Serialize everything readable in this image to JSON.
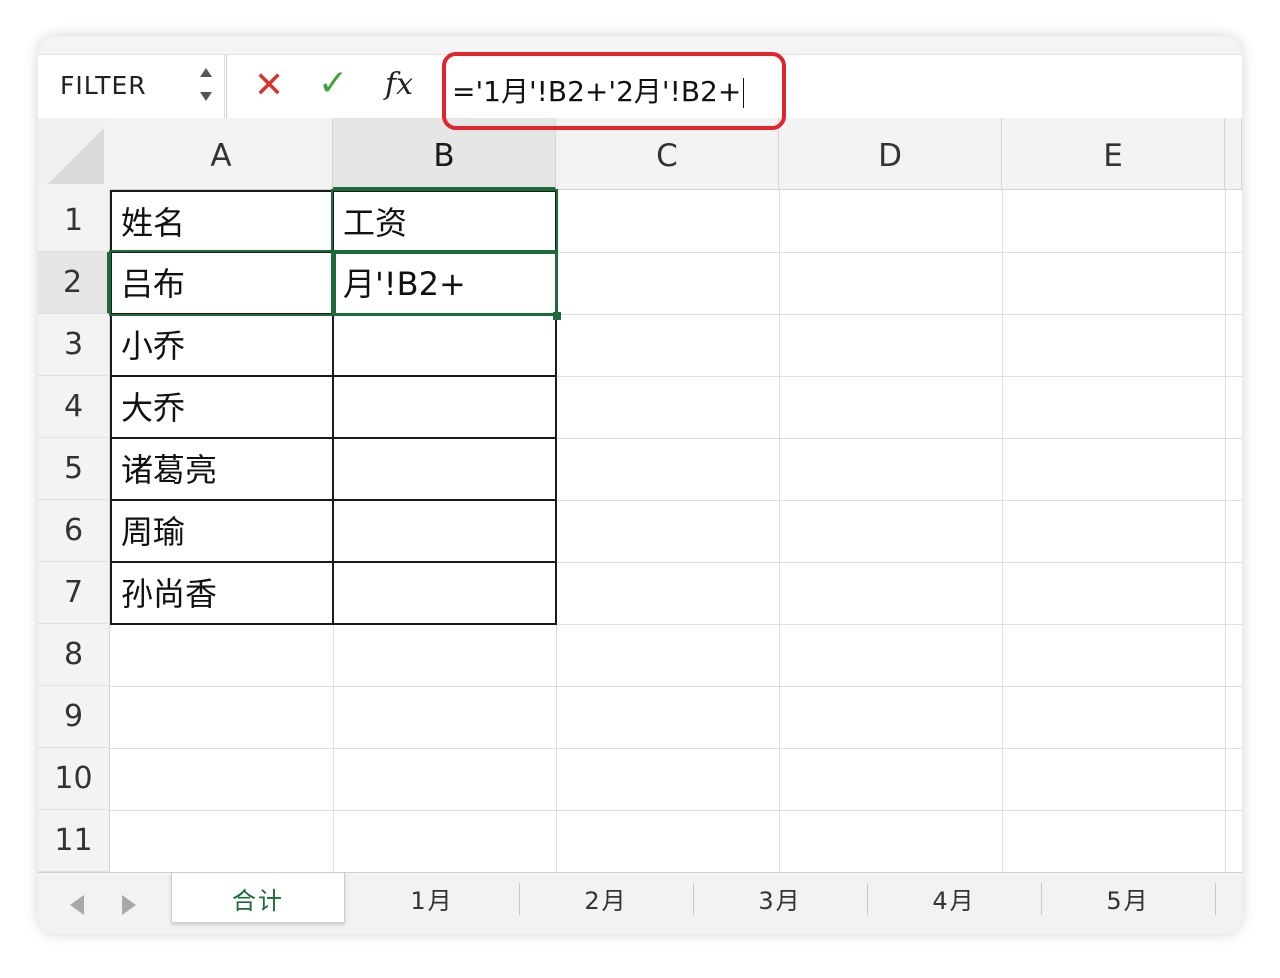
{
  "formula_bar": {
    "name_box": "FILTER",
    "cancel_icon": "✕",
    "enter_icon": "✓",
    "fx_label": "fx",
    "formula": "='1月'!B2+'2月'!B2+"
  },
  "columns": [
    "A",
    "B",
    "C",
    "D",
    "E"
  ],
  "rows": [
    "1",
    "2",
    "3",
    "4",
    "5",
    "6",
    "7",
    "8",
    "9",
    "10",
    "11"
  ],
  "cells": {
    "A1": "姓名",
    "B1": "工资",
    "A2": "吕布",
    "B2": "月'!B2+",
    "A3": "小乔",
    "A4": "大乔",
    "A5": "诸葛亮",
    "A6": "周瑜",
    "A7": "孙尚香"
  },
  "sheet_tabs": [
    "合计",
    "1月",
    "2月",
    "3月",
    "4月",
    "5月"
  ],
  "active_sheet": "合计",
  "colors": {
    "highlight_box": "#e2242b",
    "cancel": "#d9342b",
    "enter": "#3fa338",
    "selection": "#1e6b3a"
  },
  "icons": [
    "spinner-icon",
    "cancel-icon",
    "enter-icon",
    "fx-icon",
    "select-all-icon",
    "prev-sheet-icon",
    "next-sheet-icon"
  ]
}
